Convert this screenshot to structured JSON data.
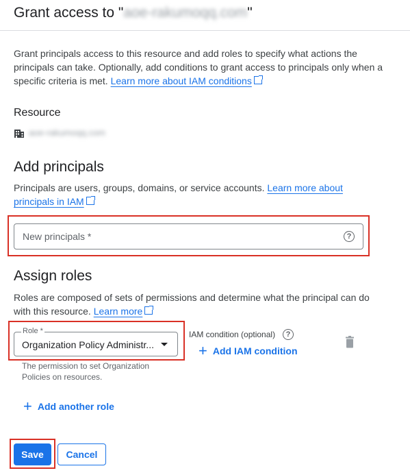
{
  "header": {
    "title_prefix": "Grant access to \"",
    "title_resource": "aoe-rakumoqq.com",
    "title_suffix": "\""
  },
  "intro": {
    "text": "Grant principals access to this resource and add roles to specify what actions the principals can take. Optionally, add conditions to grant access to principals only when a specific criteria is met.",
    "link": "Learn more about IAM conditions"
  },
  "resource": {
    "heading": "Resource",
    "name": "aoe-rakumoqq.com",
    "icon": "building-icon"
  },
  "principals": {
    "heading": "Add principals",
    "desc": "Principals are users, groups, domains, or service accounts.",
    "link": "Learn more about principals in IAM",
    "input_placeholder": "New principals *",
    "help_icon": "help-circle-icon"
  },
  "roles": {
    "heading": "Assign roles",
    "desc": "Roles are composed of sets of permissions and determine what the principal can do with this resource.",
    "link": "Learn more",
    "role_label": "Role *",
    "role_value": "Organization Policy Administr...",
    "role_hint": "The permission to set Organization Policies on resources.",
    "condition_label": "IAM condition (optional)",
    "add_condition": "Add IAM condition",
    "add_another_role": "Add another role"
  },
  "actions": {
    "save": "Save",
    "cancel": "Cancel"
  },
  "colors": {
    "accent": "#1a73e8",
    "highlight": "#d93025",
    "text": "#202124"
  }
}
